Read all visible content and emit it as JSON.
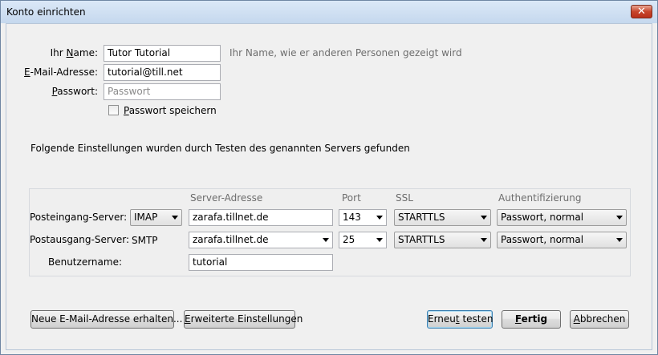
{
  "window": {
    "title": "Konto einrichten",
    "close_glyph": "✕"
  },
  "form": {
    "name_label_pre": "Ihr ",
    "name_label_key": "N",
    "name_label_post": "ame:",
    "name_value": "Tutor Tutorial",
    "name_hint": "Ihr Name, wie er anderen Personen gezeigt wird",
    "email_label_key": "E",
    "email_label_post": "-Mail-Adresse:",
    "email_value": "tutorial@till.net",
    "password_label_key": "P",
    "password_label_post": "asswort:",
    "password_placeholder": "Passwort",
    "save_password_key": "P",
    "save_password_post": "asswort speichern",
    "save_password_checked": false
  },
  "message": "Folgende Einstellungen wurden durch Testen des genannten Servers gefunden",
  "server": {
    "col_address": "Server-Adresse",
    "col_port": "Port",
    "col_ssl": "SSL",
    "col_auth": "Authentifizierung",
    "incoming_label": "Posteingang-Server:",
    "incoming_protocol": "IMAP",
    "incoming_address": "zarafa.tillnet.de",
    "incoming_port": "143",
    "incoming_ssl": "STARTTLS",
    "incoming_auth": "Passwort, normal",
    "outgoing_label": "Postausgang-Server:",
    "outgoing_protocol": "SMTP",
    "outgoing_address": "zarafa.tillnet.de",
    "outgoing_port": "25",
    "outgoing_ssl": "STARTTLS",
    "outgoing_auth": "Passwort, normal",
    "username_label": "Benutzername:",
    "username_value": "tutorial"
  },
  "buttons": {
    "new_address": "Neue E-Mail-Adresse erhalten...",
    "advanced_key": "E",
    "advanced_post": "rweiterte Einstellungen",
    "retest_pre": "Erneu",
    "retest_key": "t",
    "retest_post": " testen",
    "done_key": "F",
    "done_post": "ertig",
    "cancel_key": "A",
    "cancel_post": "bbrechen"
  },
  "icons": {
    "close": "close-icon",
    "dropdown": "chevron-down-icon",
    "checkbox": "checkbox-icon"
  }
}
